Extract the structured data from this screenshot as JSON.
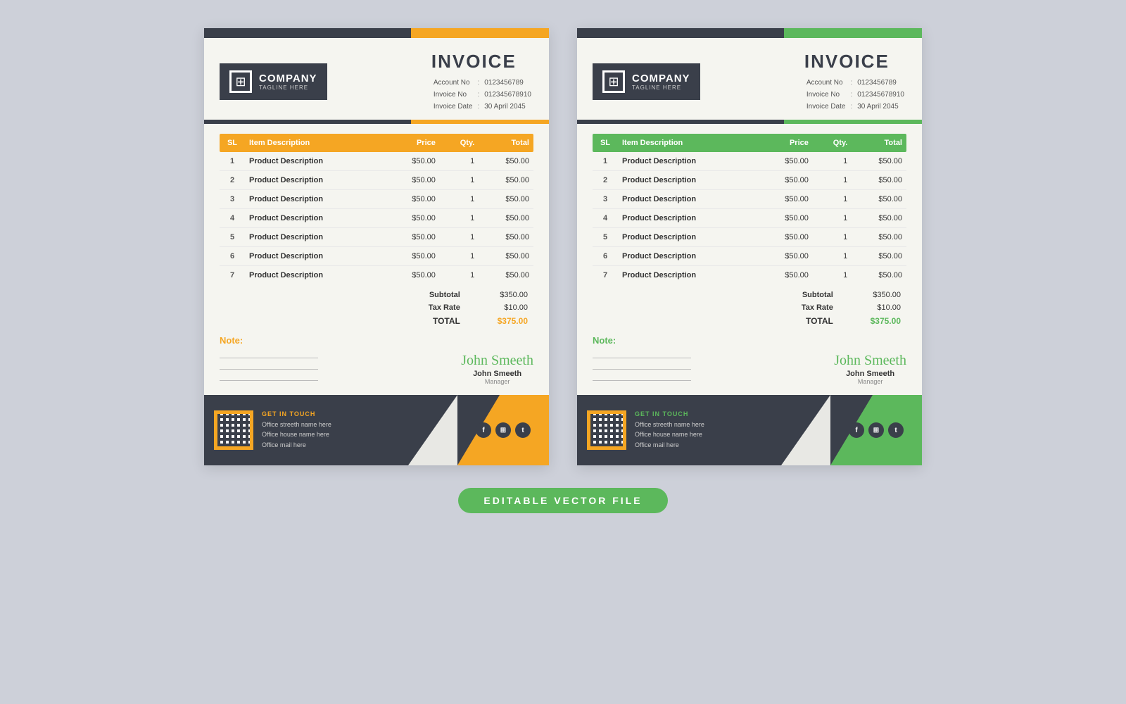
{
  "invoice1": {
    "accent": "orange",
    "accentColor": "#f5a623",
    "title": "INVOICE",
    "company": "COMPANY",
    "tagline": "TAGLINE HERE",
    "accountNo": {
      "label": "Account No",
      "value": "0123456789"
    },
    "invoiceNo": {
      "label": "Invoice No",
      "value": "012345678910"
    },
    "invoiceDate": {
      "label": "Invoice Date",
      "value": "30 April 2045"
    },
    "table": {
      "headers": [
        "SL",
        "Item Description",
        "Price",
        "Qty.",
        "Total"
      ],
      "rows": [
        [
          "1",
          "Product Description",
          "$50.00",
          "1",
          "$50.00"
        ],
        [
          "2",
          "Product Description",
          "$50.00",
          "1",
          "$50.00"
        ],
        [
          "3",
          "Product Description",
          "$50.00",
          "1",
          "$50.00"
        ],
        [
          "4",
          "Product Description",
          "$50.00",
          "1",
          "$50.00"
        ],
        [
          "5",
          "Product Description",
          "$50.00",
          "1",
          "$50.00"
        ],
        [
          "6",
          "Product Description",
          "$50.00",
          "1",
          "$50.00"
        ],
        [
          "7",
          "Product Description",
          "$50.00",
          "1",
          "$50.00"
        ]
      ]
    },
    "subtotal": {
      "label": "Subtotal",
      "value": "$350.00"
    },
    "taxRate": {
      "label": "Tax Rate",
      "value": "$10.00"
    },
    "total": {
      "label": "TOTAL",
      "value": "$375.00"
    },
    "note": {
      "label": "Note:"
    },
    "signature": {
      "script": "John Smeeth",
      "name": "John Smeeth",
      "title": "Manager"
    },
    "footer": {
      "getInTouch": "GET IN TOUCH",
      "address": [
        "Office streeth name here",
        "Office house name here",
        "Office mail here"
      ],
      "socialIcons": [
        "f",
        "⊞",
        "t"
      ]
    }
  },
  "invoice2": {
    "accent": "green",
    "accentColor": "#5cb85c",
    "title": "INVOICE",
    "company": "COMPANY",
    "tagline": "TAGLINE HERE",
    "accountNo": {
      "label": "Account No",
      "value": "0123456789"
    },
    "invoiceNo": {
      "label": "Invoice No",
      "value": "012345678910"
    },
    "invoiceDate": {
      "label": "Invoice Date",
      "value": "30 April 2045"
    },
    "table": {
      "headers": [
        "SL",
        "Item Description",
        "Price",
        "Qty.",
        "Total"
      ],
      "rows": [
        [
          "1",
          "Product Description",
          "$50.00",
          "1",
          "$50.00"
        ],
        [
          "2",
          "Product Description",
          "$50.00",
          "1",
          "$50.00"
        ],
        [
          "3",
          "Product Description",
          "$50.00",
          "1",
          "$50.00"
        ],
        [
          "4",
          "Product Description",
          "$50.00",
          "1",
          "$50.00"
        ],
        [
          "5",
          "Product Description",
          "$50.00",
          "1",
          "$50.00"
        ],
        [
          "6",
          "Product Description",
          "$50.00",
          "1",
          "$50.00"
        ],
        [
          "7",
          "Product Description",
          "$50.00",
          "1",
          "$50.00"
        ]
      ]
    },
    "subtotal": {
      "label": "Subtotal",
      "value": "$350.00"
    },
    "taxRate": {
      "label": "Tax Rate",
      "value": "$10.00"
    },
    "total": {
      "label": "TOTAL",
      "value": "$375.00"
    },
    "note": {
      "label": "Note:"
    },
    "signature": {
      "script": "John Smeeth",
      "name": "John Smeeth",
      "title": "Manager"
    },
    "footer": {
      "getInTouch": "GET IN TOUCH",
      "address": [
        "Office streeth name here",
        "Office house name here",
        "Office mail here"
      ],
      "socialIcons": [
        "f",
        "⊞",
        "t"
      ]
    }
  },
  "bottomLabel": "EDITABLE VECTOR  FILE"
}
